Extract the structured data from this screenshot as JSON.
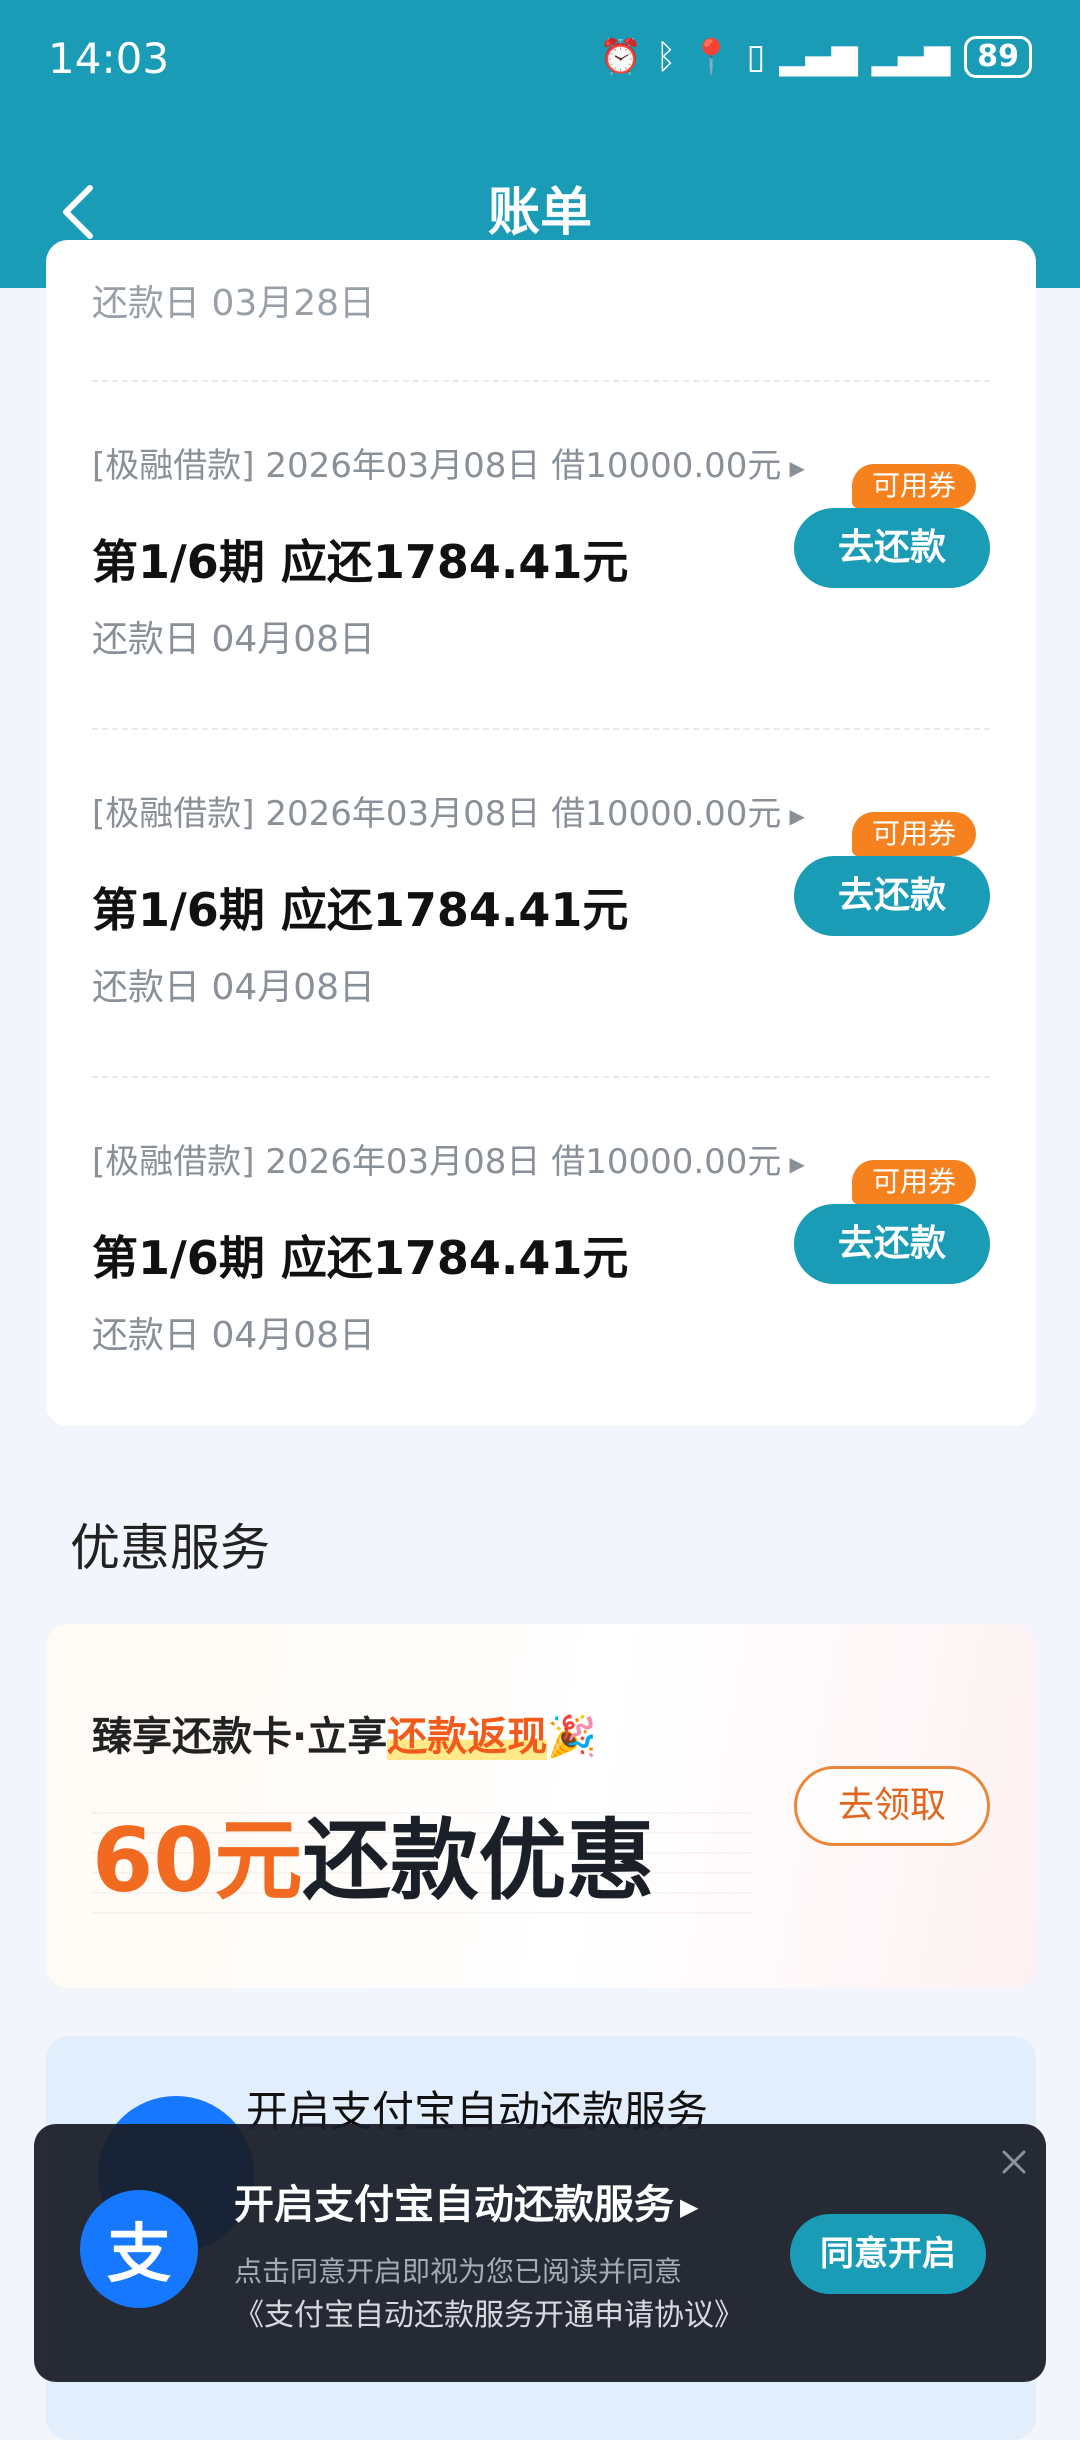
{
  "status_bar": {
    "time": "14:03",
    "icons": [
      "alarm-icon",
      "bluetooth-icon",
      "location-icon",
      "vibrate-icon",
      "signal-icon",
      "signal-icon"
    ],
    "battery": "89"
  },
  "header": {
    "back_icon": "chevron-left-icon",
    "title": "账单"
  },
  "bills": {
    "previous_due": "还款日 03月28日",
    "items": [
      {
        "meta": "[极融借款] 2026年03月08日 借10000.00元",
        "amount": "第1/6期 应还1784.41元",
        "due": "还款日 04月08日",
        "coupon": "可用券",
        "button": "去还款"
      },
      {
        "meta": "[极融借款] 2026年03月08日 借10000.00元",
        "amount": "第1/6期 应还1784.41元",
        "due": "还款日 04月08日",
        "coupon": "可用券",
        "button": "去还款"
      },
      {
        "meta": "[极融借款] 2026年03月08日 借10000.00元",
        "amount": "第1/6期 应还1784.41元",
        "due": "还款日 04月08日",
        "coupon": "可用券",
        "button": "去还款"
      }
    ]
  },
  "services": {
    "title": "优惠服务",
    "promo": {
      "line1_prefix": "臻享还款卡·立享",
      "line1_highlight": "还款返现",
      "emoji": "🎉",
      "amount_number": "60元",
      "amount_text": "还款优惠",
      "button": "去领取"
    },
    "autopay_card": {
      "title": "开启支付宝自动还款服务"
    }
  },
  "toast": {
    "logo": "支",
    "title": "开启支付宝自动还款服务",
    "desc": "点击同意开启即视为您已阅读并同意",
    "agreement": "《支付宝自动还款服务开通申请协议》",
    "button": "同意开启",
    "close_icon": "close-icon"
  },
  "colors": {
    "header": "#1a9cb6",
    "accent_orange": "#f26a1f",
    "coupon": "#f5821f",
    "alipay_blue": "#1677ff"
  }
}
